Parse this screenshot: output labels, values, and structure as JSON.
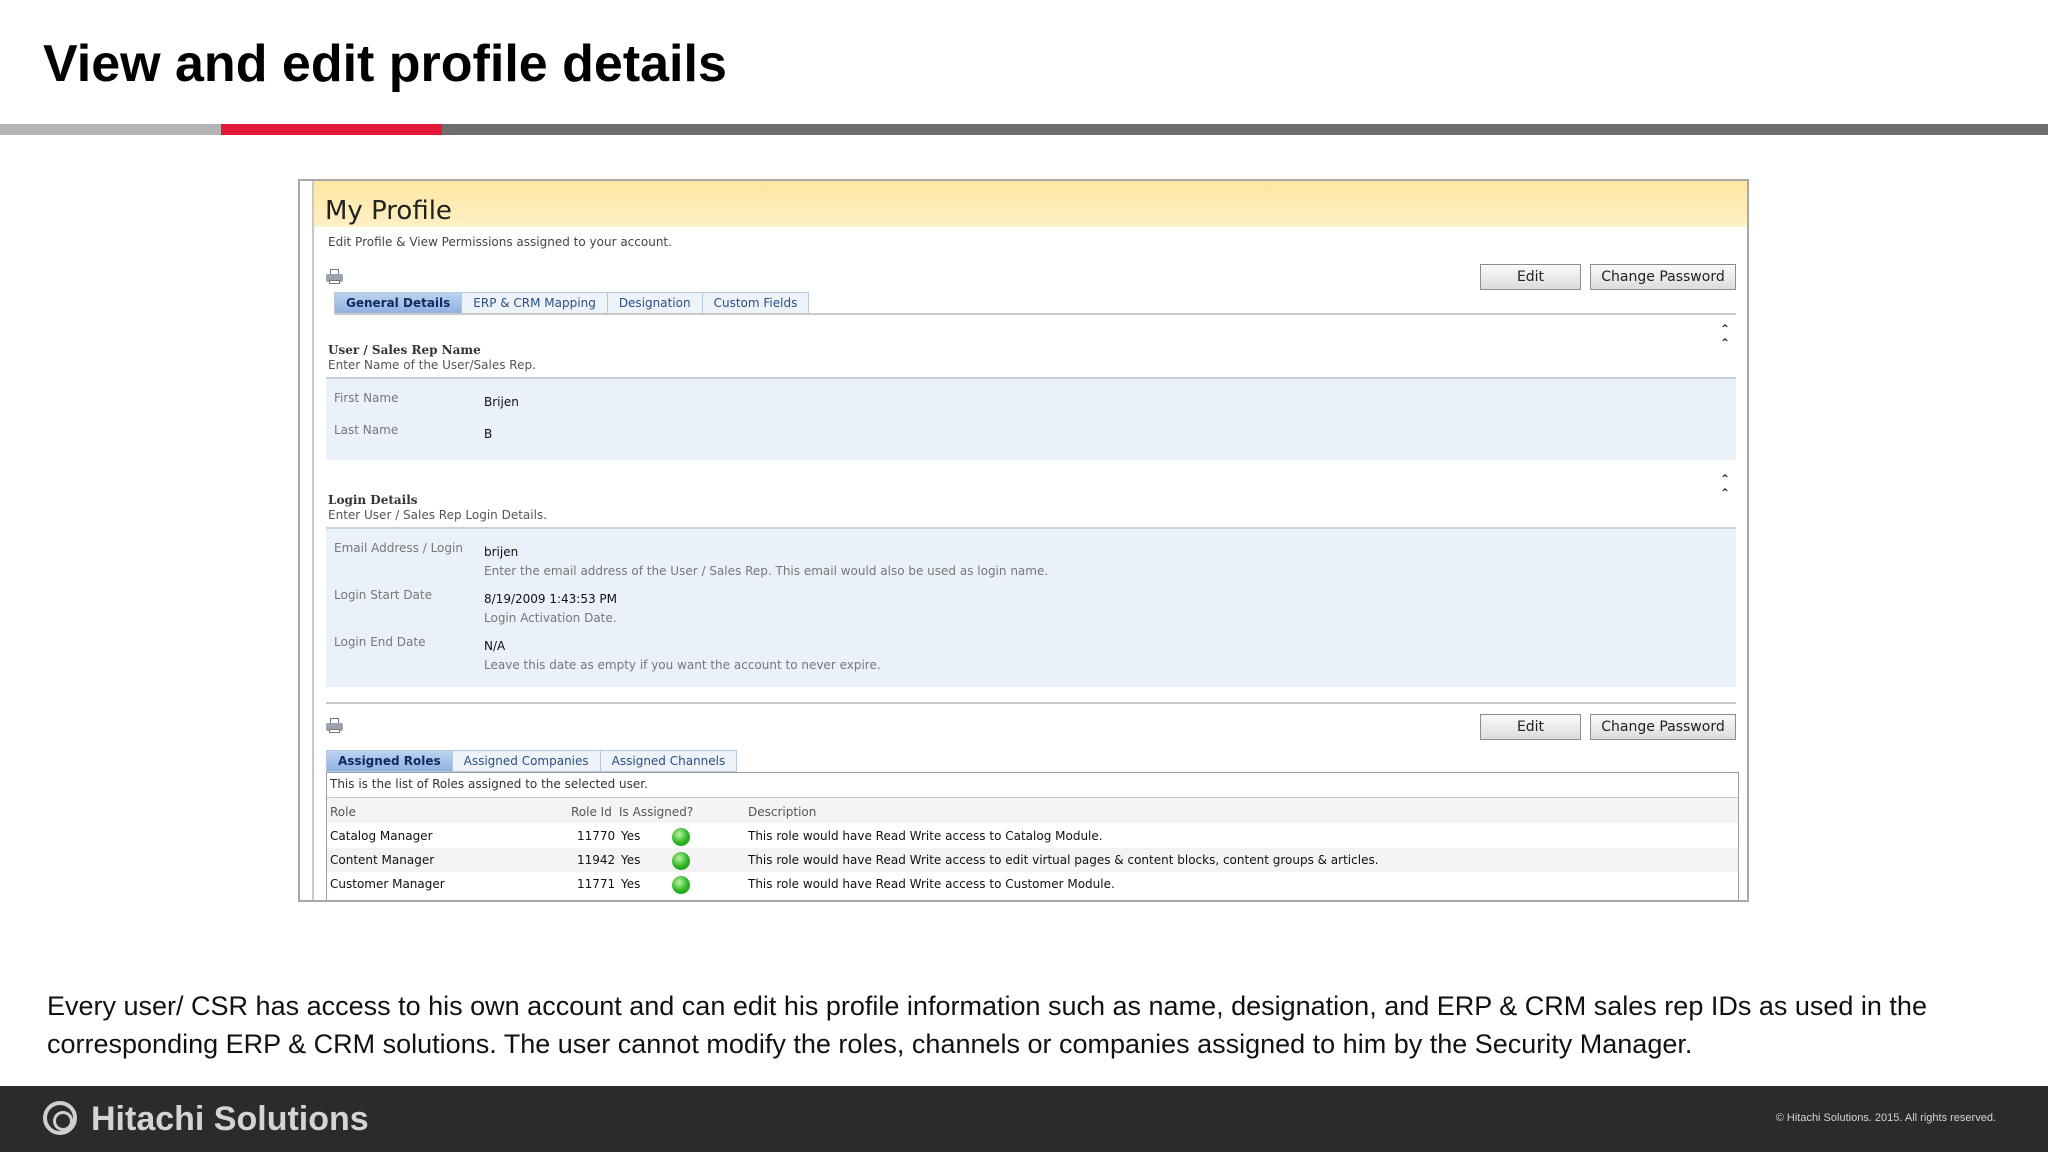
{
  "slide": {
    "title": "View and edit profile details",
    "description": "Every user/ CSR has access to his own account and can edit his profile information such as name, designation, and ERP & CRM sales rep IDs as used in the corresponding ERP & CRM solutions. The user cannot modify the roles, channels or companies assigned to him by the Security Manager."
  },
  "colors": {
    "accent": "#e31937",
    "rule_grey": "#6e6e6e",
    "header_band": "#ffe7a2",
    "footer": "#2b2b2b"
  },
  "profile": {
    "title": "My Profile",
    "subtitle": "Edit Profile & View Permissions assigned to your account.",
    "edit_label": "Edit",
    "change_password_label": "Change Password",
    "tabs": [
      "General Details",
      "ERP & CRM Mapping",
      "Designation",
      "Custom Fields"
    ],
    "active_tab": "General Details",
    "collapse_icon": "double-chevron-up-icon",
    "name_section": {
      "title": "User / Sales Rep Name",
      "subtitle": "Enter Name of the User/Sales Rep.",
      "first_name_label": "First Name",
      "first_name": "Brijen",
      "last_name_label": "Last Name",
      "last_name": "B"
    },
    "login_section": {
      "title": "Login Details",
      "subtitle": "Enter User / Sales Rep Login Details.",
      "email_label": "Email Address / Login",
      "email": "brijen",
      "email_hint": "Enter the email address of the User / Sales Rep. This email would also be used as login name.",
      "start_label": "Login Start Date",
      "start": "8/19/2009 1:43:53 PM",
      "start_hint": "Login Activation Date.",
      "end_label": "Login End Date",
      "end": "N/A",
      "end_hint": "Leave this date as empty if you want the account to never expire."
    },
    "assign_tabs": [
      "Assigned Roles",
      "Assigned Companies",
      "Assigned Channels"
    ],
    "roles_note": "This is the list of Roles assigned to the selected user.",
    "roles_headers": [
      "Role",
      "Role Id",
      "Is Assigned?",
      "Description"
    ],
    "roles": [
      {
        "role": "Catalog Manager",
        "id": "11770",
        "assigned": "Yes",
        "description": "This role would have Read Write access to Catalog Module."
      },
      {
        "role": "Content Manager",
        "id": "11942",
        "assigned": "Yes",
        "description": "This role would have Read Write access to edit virtual pages & content blocks, content groups & articles."
      },
      {
        "role": "Customer Manager",
        "id": "11771",
        "assigned": "Yes",
        "description": "This role would have Read Write access to Customer Module."
      }
    ]
  },
  "footer": {
    "brand": "Hitachi Solutions",
    "copyright": "© Hitachi Solutions. 2015. All rights reserved."
  }
}
